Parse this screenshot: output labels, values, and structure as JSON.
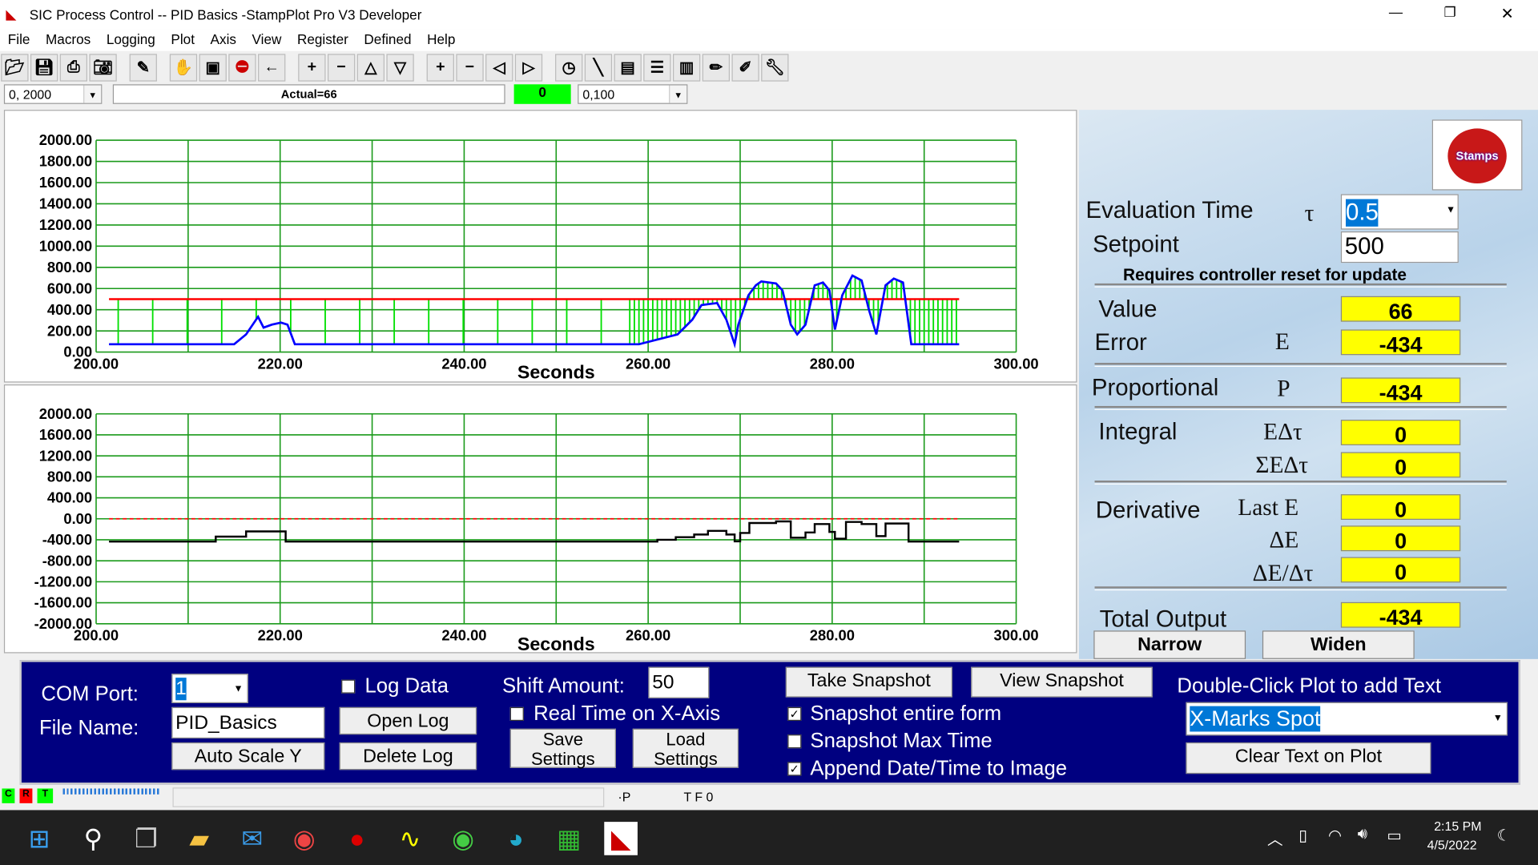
{
  "window": {
    "title": "SIC Process Control -- PID Basics -StampPlot Pro V3 Developer",
    "minimize": "—",
    "restore": "❐",
    "close": "✕"
  },
  "menu": [
    "File",
    "Macros",
    "Logging",
    "Plot",
    "Axis",
    "View",
    "Register",
    "Defined",
    "Help"
  ],
  "toolbar": {
    "icons": [
      "open-folder",
      "save",
      "print",
      "camera",
      "magic-wand",
      "handshake",
      "monitor",
      "stop",
      "arrow-left",
      "plus",
      "minus",
      "up-triangle",
      "down-triangle",
      "plus",
      "minus",
      "left-triangle",
      "right-triangle",
      "clock",
      "pen",
      "chart-table",
      "notes",
      "notepad",
      "pencil-tool",
      "edit-image",
      "wrench"
    ]
  },
  "statusrow": {
    "y_range": "0, 2000",
    "message": "Actual=66",
    "green_value": "0",
    "x_range": "0,100"
  },
  "chart_data": [
    {
      "type": "line",
      "xlabel": "Seconds",
      "xlim": [
        200,
        300
      ],
      "ylim": [
        0,
        2000
      ],
      "grid": true,
      "x_ticks": [
        "200.00",
        "220.00",
        "240.00",
        "260.00",
        "280.00",
        "300.00"
      ],
      "y_ticks": [
        "2000.00",
        "1800.00",
        "1600.00",
        "1400.00",
        "1200.00",
        "1000.00",
        "800.00",
        "600.00",
        "400.00",
        "200.00",
        "0.00"
      ],
      "setpoint": {
        "value": 500,
        "x": [
          201.4,
          293.8
        ],
        "color": "#ff0000"
      },
      "error_bar_color": "#00e000",
      "series": [
        {
          "color": "#0000ff",
          "x": [
            201.4,
            215.0,
            216.3,
            217.6,
            218.2,
            219.1,
            220.1,
            220.8,
            221.4,
            221.6,
            251.0,
            259.0,
            263.2,
            264.8,
            265.8,
            267.5,
            268.5,
            269.4,
            269.8,
            270.9,
            271.7,
            272.3,
            273.9,
            274.6,
            275.5,
            276.2,
            277.1,
            278.1,
            279.0,
            279.7,
            280.3,
            281.1,
            282.2,
            283.2,
            284.0,
            284.8,
            285.8,
            286.7,
            287.7,
            288.6,
            293.8
          ],
          "y": [
            74,
            74,
            167,
            333,
            231,
            259,
            278,
            259,
            120,
            74,
            74,
            74,
            167,
            306,
            444,
            463,
            306,
            74,
            259,
            537,
            630,
            667,
            648,
            583,
            259,
            167,
            259,
            630,
            657,
            583,
            213,
            537,
            722,
            676,
            398,
            167,
            630,
            694,
            657,
            74,
            74
          ]
        }
      ]
    },
    {
      "type": "line",
      "xlabel": "Seconds",
      "xlim": [
        200,
        300
      ],
      "ylim": [
        -2000,
        2000
      ],
      "grid": true,
      "x_ticks": [
        "200.00",
        "220.00",
        "240.00",
        "260.00",
        "280.00",
        "300.00"
      ],
      "y_ticks": [
        "2000.00",
        "1600.00",
        "1200.00",
        "800.00",
        "400.00",
        "0.00",
        "-400.00",
        "-800.00",
        "-1200.00",
        "-1600.00",
        "-2000.00"
      ],
      "reference": {
        "value": 0,
        "color": "#ff0000",
        "style": "dashed"
      },
      "series": [
        {
          "color": "#000000",
          "style": "step",
          "x": [
            201.4,
            213.0,
            216.3,
            220.6,
            259.0,
            261,
            263,
            265,
            266.5,
            268.5,
            269.4,
            270,
            271,
            273.9,
            275.5,
            277.1,
            278.1,
            279.7,
            280.3,
            281.5,
            283.2,
            284.8,
            285.8,
            288.3,
            293.8
          ],
          "y": [
            -434,
            -340,
            -240,
            -434,
            -434,
            -400,
            -350,
            -300,
            -230,
            -300,
            -430,
            -270,
            -80,
            -50,
            -360,
            -260,
            -100,
            -250,
            -380,
            -60,
            -100,
            -330,
            -90,
            -434,
            -434
          ]
        }
      ]
    }
  ],
  "panel": {
    "eval_label": "Evaluation Time",
    "tau": "τ",
    "eval_value": "0.5",
    "setpoint_label": "Setpoint",
    "setpoint_value": "500",
    "note": "Requires controller reset for update",
    "value_label": "Value",
    "value": "66",
    "error_label": "Error",
    "error_sym": "E",
    "error": "-434",
    "prop_label": "Proportional",
    "prop_sym": "P",
    "prop": "-434",
    "int_label": "Integral",
    "int_sym1": "EΔτ",
    "int1": "0",
    "int_sym2": "ΣEΔτ",
    "int2": "0",
    "der_label": "Derivative",
    "der_sym1": "Last E",
    "der1": "0",
    "der_sym2": "ΔE",
    "der2": "0",
    "der_sym3": "ΔE/Δτ",
    "der3": "0",
    "total_label": "Total Output",
    "total": "-434",
    "narrow": "Narrow",
    "widen": "Widen",
    "logo": "Stamps in Class"
  },
  "bottom": {
    "com_label": "COM Port:",
    "com_value": "1",
    "file_label": "File Name:",
    "file_value": "PID_Basics",
    "autoscale": "Auto Scale Y",
    "log_data": "Log Data",
    "log_checked": false,
    "open_log": "Open Log",
    "delete_log": "Delete Log",
    "shift_label": "Shift Amount:",
    "shift_value": "50",
    "realtime": "Real Time on X-Axis",
    "realtime_checked": false,
    "save_settings": "Save Settings",
    "load_settings": "Load Settings",
    "take_snapshot": "Take Snapshot",
    "view_snapshot": "View Snapshot",
    "snap_entire": "Snapshot entire form",
    "snap_entire_checked": true,
    "snap_max": "Snapshot Max Time",
    "snap_max_checked": false,
    "append_dt": "Append Date/Time to Image",
    "append_dt_checked": true,
    "dblclick_label": "Double-Click Plot to add Text",
    "text_value": "X-Marks Spot",
    "clear_text": "Clear Text on Plot"
  },
  "status": {
    "c": "C",
    "r": "R",
    "t": "T",
    "p": "·P",
    "tfo": "T F 0"
  },
  "taskbar": {
    "time": "2:15 PM",
    "date": "4/5/2022"
  }
}
